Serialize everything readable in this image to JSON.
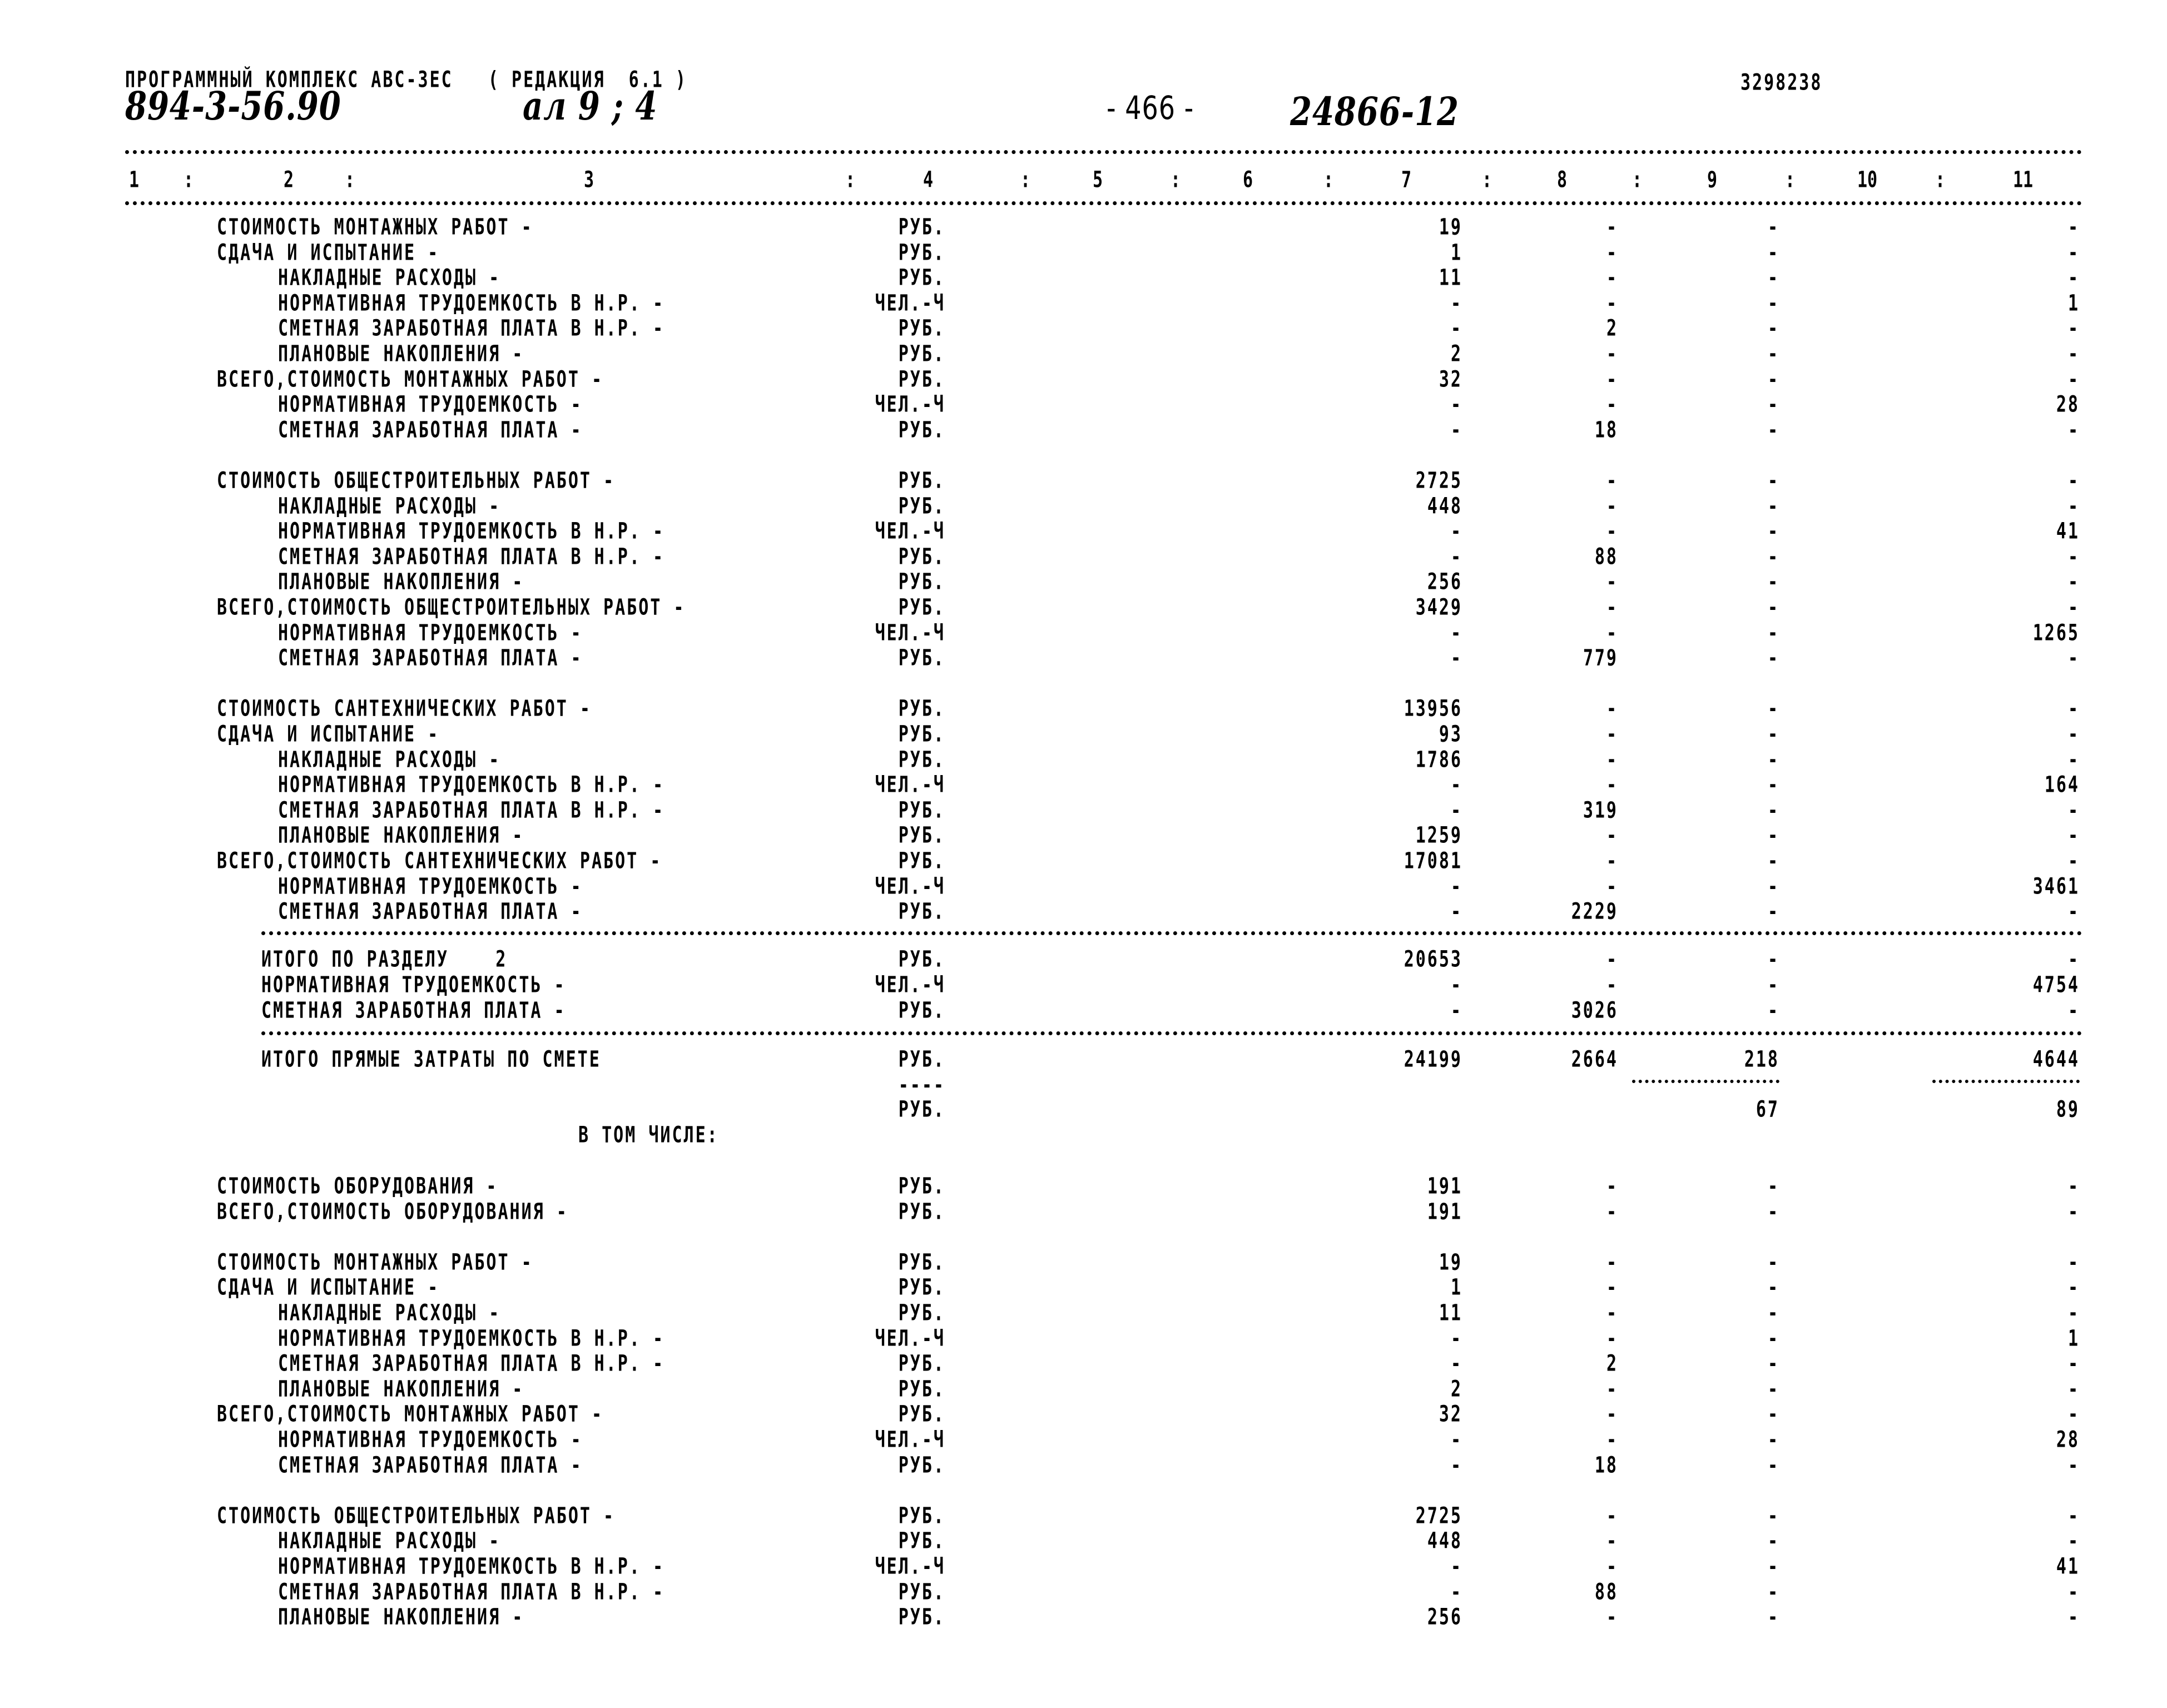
{
  "header": {
    "program_line": "ПРОГРАММНЫЙ КОМПЛЕКС АВС-ЗЕС   ( РЕДАКЦИЯ  6.1 )",
    "doc_code_handwritten": "894-3-56.90",
    "album_handwritten": "ал 9 ; 4",
    "page_number": "- 466 -",
    "sheet_code_handwritten": "24866-12",
    "print_id": "3298238"
  },
  "columns": {
    "labels": [
      "1",
      "2",
      "3",
      "4",
      "5",
      "6",
      "7",
      "8",
      "9",
      "10",
      "11"
    ],
    "separator": ":"
  },
  "rows": [
    {
      "label": "СТОИМОСТЬ МОНТАЖНЫХ РАБОТ -",
      "indent": 0,
      "unit": "РУБ.",
      "c7": "19",
      "c8": "-",
      "c9": "-",
      "c11": "-"
    },
    {
      "label": "СДАЧА И ИСПЫТАНИЕ -",
      "indent": 0,
      "unit": "РУБ.",
      "c7": "1",
      "c8": "-",
      "c9": "-",
      "c11": "-"
    },
    {
      "label": "НАКЛАДНЫЕ РАСХОДЫ -",
      "indent": 1,
      "unit": "РУБ.",
      "c7": "11",
      "c8": "-",
      "c9": "-",
      "c11": "-"
    },
    {
      "label": "НОРМАТИВНАЯ ТРУДОЕМКОСТЬ В Н.Р. -",
      "indent": 1,
      "unit": "ЧЕЛ.-Ч",
      "c7": "-",
      "c8": "-",
      "c9": "-",
      "c11": "1"
    },
    {
      "label": "СМЕТНАЯ ЗАРАБОТНАЯ ПЛАТА В Н.Р. -",
      "indent": 1,
      "unit": "РУБ.",
      "c7": "-",
      "c8": "2",
      "c9": "-",
      "c11": "-"
    },
    {
      "label": "ПЛАНОВЫЕ НАКОПЛЕНИЯ -",
      "indent": 1,
      "unit": "РУБ.",
      "c7": "2",
      "c8": "-",
      "c9": "-",
      "c11": "-"
    },
    {
      "label": "ВСЕГО,СТОИМОСТЬ МОНТАЖНЫХ РАБОТ -",
      "indent": 0,
      "unit": "РУБ.",
      "c7": "32",
      "c8": "-",
      "c9": "-",
      "c11": "-"
    },
    {
      "label": "НОРМАТИВНАЯ ТРУДОЕМКОСТЬ -",
      "indent": 1,
      "unit": "ЧЕЛ.-Ч",
      "c7": "-",
      "c8": "-",
      "c9": "-",
      "c11": "28"
    },
    {
      "label": "СМЕТНАЯ ЗАРАБОТНАЯ ПЛАТА -",
      "indent": 1,
      "unit": "РУБ.",
      "c7": "-",
      "c8": "18",
      "c9": "-",
      "c11": "-"
    },
    {
      "blank": true
    },
    {
      "label": "СТОИМОСТЬ ОБЩЕСТРОИТЕЛЬНЫХ РАБОТ -",
      "indent": 0,
      "unit": "РУБ.",
      "c7": "2725",
      "c8": "-",
      "c9": "-",
      "c11": "-"
    },
    {
      "label": "НАКЛАДНЫЕ РАСХОДЫ -",
      "indent": 1,
      "unit": "РУБ.",
      "c7": "448",
      "c8": "-",
      "c9": "-",
      "c11": "-"
    },
    {
      "label": "НОРМАТИВНАЯ ТРУДОЕМКОСТЬ В Н.Р. -",
      "indent": 1,
      "unit": "ЧЕЛ.-Ч",
      "c7": "-",
      "c8": "-",
      "c9": "-",
      "c11": "41"
    },
    {
      "label": "СМЕТНАЯ ЗАРАБОТНАЯ ПЛАТА В Н.Р. -",
      "indent": 1,
      "unit": "РУБ.",
      "c7": "-",
      "c8": "88",
      "c9": "-",
      "c11": "-"
    },
    {
      "label": "ПЛАНОВЫЕ НАКОПЛЕНИЯ -",
      "indent": 1,
      "unit": "РУБ.",
      "c7": "256",
      "c8": "-",
      "c9": "-",
      "c11": "-"
    },
    {
      "label": "ВСЕГО,СТОИМОСТЬ ОБЩЕСТРОИТЕЛЬНЫХ РАБОТ -",
      "indent": 0,
      "unit": "РУБ.",
      "c7": "3429",
      "c8": "-",
      "c9": "-",
      "c11": "-"
    },
    {
      "label": "НОРМАТИВНАЯ ТРУДОЕМКОСТЬ -",
      "indent": 1,
      "unit": "ЧЕЛ.-Ч",
      "c7": "-",
      "c8": "-",
      "c9": "-",
      "c11": "1265"
    },
    {
      "label": "СМЕТНАЯ ЗАРАБОТНАЯ ПЛАТА -",
      "indent": 1,
      "unit": "РУБ.",
      "c7": "-",
      "c8": "779",
      "c9": "-",
      "c11": "-"
    },
    {
      "blank": true
    },
    {
      "label": "СТОИМОСТЬ САНТЕХНИЧЕСКИХ РАБОТ -",
      "indent": 0,
      "unit": "РУБ.",
      "c7": "13956",
      "c8": "-",
      "c9": "-",
      "c11": "-"
    },
    {
      "label": "СДАЧА И ИСПЫТАНИЕ -",
      "indent": 0,
      "unit": "РУБ.",
      "c7": "93",
      "c8": "-",
      "c9": "-",
      "c11": "-"
    },
    {
      "label": "НАКЛАДНЫЕ РАСХОДЫ -",
      "indent": 1,
      "unit": "РУБ.",
      "c7": "1786",
      "c8": "-",
      "c9": "-",
      "c11": "-"
    },
    {
      "label": "НОРМАТИВНАЯ ТРУДОЕМКОСТЬ В Н.Р. -",
      "indent": 1,
      "unit": "ЧЕЛ.-Ч",
      "c7": "-",
      "c8": "-",
      "c9": "-",
      "c11": "164"
    },
    {
      "label": "СМЕТНАЯ ЗАРАБОТНАЯ ПЛАТА В Н.Р. -",
      "indent": 1,
      "unit": "РУБ.",
      "c7": "-",
      "c8": "319",
      "c9": "-",
      "c11": "-"
    },
    {
      "label": "ПЛАНОВЫЕ НАКОПЛЕНИЯ -",
      "indent": 1,
      "unit": "РУБ.",
      "c7": "1259",
      "c8": "-",
      "c9": "-",
      "c11": "-"
    },
    {
      "label": "ВСЕГО,СТОИМОСТЬ САНТЕХНИЧЕСКИХ РАБОТ -",
      "indent": 0,
      "unit": "РУБ.",
      "c7": "17081",
      "c8": "-",
      "c9": "-",
      "c11": "-"
    },
    {
      "label": "НОРМАТИВНАЯ ТРУДОЕМКОСТЬ -",
      "indent": 1,
      "unit": "ЧЕЛ.-Ч",
      "c7": "-",
      "c8": "-",
      "c9": "-",
      "c11": "3461"
    },
    {
      "label": "СМЕТНАЯ ЗАРАБОТНАЯ ПЛАТА -",
      "indent": 1,
      "unit": "РУБ.",
      "c7": "-",
      "c8": "2229",
      "c9": "-",
      "c11": "-"
    }
  ],
  "section_total": {
    "rows": [
      {
        "label": "ИТОГО ПО РАЗДЕЛУ    2",
        "unit": "РУБ.",
        "c7": "20653",
        "c8": "-",
        "c9": "-",
        "c11": "-"
      },
      {
        "label": "НОРМАТИВНАЯ ТРУДОЕМКОСТЬ -",
        "unit": "ЧЕЛ.-Ч",
        "c7": "-",
        "c8": "-",
        "c9": "-",
        "c11": "4754"
      },
      {
        "label": "СМЕТНАЯ ЗАРАБОТНАЯ ПЛАТА -",
        "unit": "РУБ.",
        "c7": "-",
        "c8": "3026",
        "c9": "-",
        "c11": "-"
      }
    ]
  },
  "grand_total": {
    "label": "ИТОГО ПРЯМЫЕ ЗАТРАТЫ ПО СМЕТЕ",
    "unit": "РУБ.",
    "unit_dashes": "----",
    "unit2": "РУБ.",
    "c7": "24199",
    "c8": "2664",
    "c9": "218",
    "c11": "4644",
    "c9_sub": "67",
    "c11_sub": "89",
    "including_caption": "В ТОМ ЧИСЛЕ:"
  },
  "including_rows": [
    {
      "label": "СТОИМОСТЬ ОБОРУДОВАНИЯ -",
      "indent": 0,
      "unit": "РУБ.",
      "c7": "191",
      "c8": "-",
      "c9": "-",
      "c11": "-"
    },
    {
      "label": "ВСЕГО,СТОИМОСТЬ ОБОРУДОВАНИЯ -",
      "indent": 0,
      "unit": "РУБ.",
      "c7": "191",
      "c8": "-",
      "c9": "-",
      "c11": "-"
    },
    {
      "blank": true
    },
    {
      "label": "СТОИМОСТЬ МОНТАЖНЫХ РАБОТ -",
      "indent": 0,
      "unit": "РУБ.",
      "c7": "19",
      "c8": "-",
      "c9": "-",
      "c11": "-"
    },
    {
      "label": "СДАЧА И ИСПЫТАНИЕ -",
      "indent": 0,
      "unit": "РУБ.",
      "c7": "1",
      "c8": "-",
      "c9": "-",
      "c11": "-"
    },
    {
      "label": "НАКЛАДНЫЕ РАСХОДЫ -",
      "indent": 1,
      "unit": "РУБ.",
      "c7": "11",
      "c8": "-",
      "c9": "-",
      "c11": "-"
    },
    {
      "label": "НОРМАТИВНАЯ ТРУДОЕМКОСТЬ В Н.Р. -",
      "indent": 1,
      "unit": "ЧЕЛ.-Ч",
      "c7": "-",
      "c8": "-",
      "c9": "-",
      "c11": "1"
    },
    {
      "label": "СМЕТНАЯ ЗАРАБОТНАЯ ПЛАТА В Н.Р. -",
      "indent": 1,
      "unit": "РУБ.",
      "c7": "-",
      "c8": "2",
      "c9": "-",
      "c11": "-"
    },
    {
      "label": "ПЛАНОВЫЕ НАКОПЛЕНИЯ -",
      "indent": 1,
      "unit": "РУБ.",
      "c7": "2",
      "c8": "-",
      "c9": "-",
      "c11": "-"
    },
    {
      "label": "ВСЕГО,СТОИМОСТЬ МОНТАЖНЫХ РАБОТ -",
      "indent": 0,
      "unit": "РУБ.",
      "c7": "32",
      "c8": "-",
      "c9": "-",
      "c11": "-"
    },
    {
      "label": "НОРМАТИВНАЯ ТРУДОЕМКОСТЬ -",
      "indent": 1,
      "unit": "ЧЕЛ.-Ч",
      "c7": "-",
      "c8": "-",
      "c9": "-",
      "c11": "28"
    },
    {
      "label": "СМЕТНАЯ ЗАРАБОТНАЯ ПЛАТА -",
      "indent": 1,
      "unit": "РУБ.",
      "c7": "-",
      "c8": "18",
      "c9": "-",
      "c11": "-"
    },
    {
      "blank": true
    },
    {
      "label": "СТОИМОСТЬ ОБЩЕСТРОИТЕЛЬНЫХ РАБОТ -",
      "indent": 0,
      "unit": "РУБ.",
      "c7": "2725",
      "c8": "-",
      "c9": "-",
      "c11": "-"
    },
    {
      "label": "НАКЛАДНЫЕ РАСХОДЫ -",
      "indent": 1,
      "unit": "РУБ.",
      "c7": "448",
      "c8": "-",
      "c9": "-",
      "c11": "-"
    },
    {
      "label": "НОРМАТИВНАЯ ТРУДОЕМКОСТЬ В Н.Р. -",
      "indent": 1,
      "unit": "ЧЕЛ.-Ч",
      "c7": "-",
      "c8": "-",
      "c9": "-",
      "c11": "41"
    },
    {
      "label": "СМЕТНАЯ ЗАРАБОТНАЯ ПЛАТА В Н.Р. -",
      "indent": 1,
      "unit": "РУБ.",
      "c7": "-",
      "c8": "88",
      "c9": "-",
      "c11": "-"
    },
    {
      "label": "ПЛАНОВЫЕ НАКОПЛЕНИЯ -",
      "indent": 1,
      "unit": "РУБ.",
      "c7": "256",
      "c8": "-",
      "c9": "-",
      "c11": "-"
    }
  ]
}
